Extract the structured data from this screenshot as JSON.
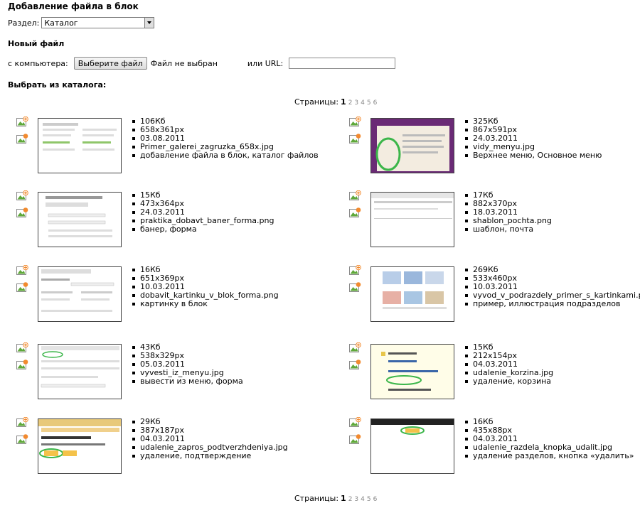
{
  "page": {
    "title": "Добавление файла в блок",
    "section_label": "Раздел:",
    "section_value": "Каталог",
    "new_file_heading": "Новый файл",
    "from_computer_label": "с компьютера:",
    "choose_file_button": "Выберите файл",
    "no_file_text": "Файл не выбран",
    "url_label": "или URL:",
    "url_value": "",
    "catalog_heading": "Выбрать из каталога:"
  },
  "pager": {
    "label": "Страницы:",
    "current": "1",
    "pages": [
      "2",
      "3",
      "4",
      "5",
      "6"
    ]
  },
  "icons": {
    "insert": "insert-image-icon",
    "thumb": "thumbnail-image-icon",
    "accent": "#f28a2e",
    "frame": "#8a8a8a"
  },
  "files": [
    {
      "size": "106Кб",
      "dims": "658x361px",
      "date": "03.08.2011",
      "name": "Primer_galerei_zagruzka_658x.jpg",
      "tags": "добавление файла в блок, каталог файлов"
    },
    {
      "size": "325Кб",
      "dims": "867x591px",
      "date": "24.03.2011",
      "name": "vidy_menyu.jpg",
      "tags": "Верхнее меню, Основное меню"
    },
    {
      "size": "15Кб",
      "dims": "473x364px",
      "date": "24.03.2011",
      "name": "praktika_dobavt_baner_forma.png",
      "tags": "банер, форма"
    },
    {
      "size": "17Кб",
      "dims": "882x370px",
      "date": "18.03.2011",
      "name": "shablon_pochta.png",
      "tags": "шаблон, почта"
    },
    {
      "size": "16Кб",
      "dims": "651x369px",
      "date": "10.03.2011",
      "name": "dobavit_kartinku_v_blok_forma.png",
      "tags": "картинку в блок"
    },
    {
      "size": "269Кб",
      "dims": "533x460px",
      "date": "10.03.2011",
      "name": "vyvod_v_podrazdely_primer_s_kartinkami.png",
      "tags": "пример, иллюстрация подразделов"
    },
    {
      "size": "43Кб",
      "dims": "538x329px",
      "date": "05.03.2011",
      "name": "vyvesti_iz_menyu.jpg",
      "tags": "вывести из меню, форма"
    },
    {
      "size": "15Кб",
      "dims": "212x154px",
      "date": "04.03.2011",
      "name": "udalenie_korzina.jpg",
      "tags": "удаление, корзина"
    },
    {
      "size": "29Кб",
      "dims": "387x187px",
      "date": "04.03.2011",
      "name": "udalenie_zapros_podtverzhdeniya.jpg",
      "tags": "удаление, подтверждение"
    },
    {
      "size": "16Кб",
      "dims": "435x88px",
      "date": "04.03.2011",
      "name": "udalenie_razdela_knopka_udalit.jpg",
      "tags": "удаление разделов, кнопка «удалить»"
    }
  ]
}
